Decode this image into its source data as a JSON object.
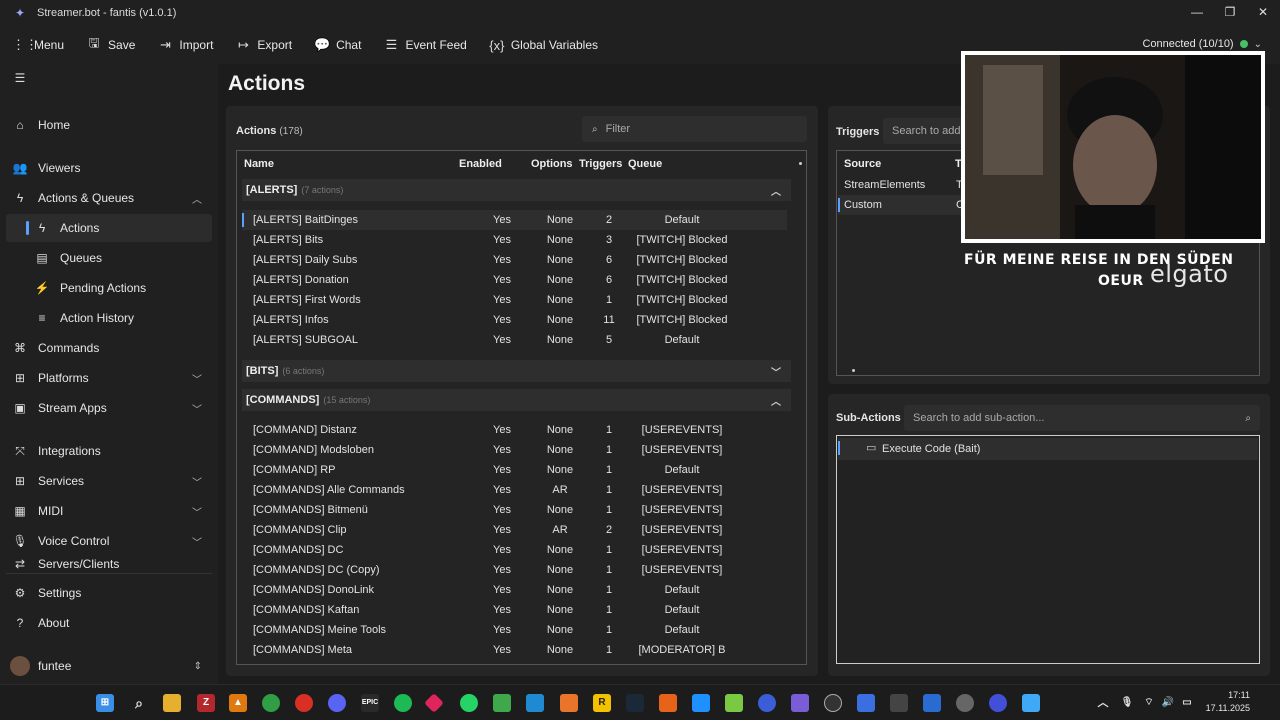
{
  "window": {
    "title": "Streamer.bot - fantis (v1.0.1)",
    "minimize_icon": "minimize-icon",
    "maximize_icon": "restore-icon",
    "close_icon": "close-icon"
  },
  "toolbar": {
    "menu": "Menu",
    "save": "Save",
    "import": "Import",
    "export": "Export",
    "chat": "Chat",
    "event_feed": "Event Feed",
    "global_variables": "Global Variables",
    "connection": "Connected (10/10)",
    "connection_color": "#44c16a"
  },
  "sidebar": {
    "home": "Home",
    "viewers": "Viewers",
    "actions_queues": "Actions & Queues",
    "actions": "Actions",
    "queues": "Queues",
    "pending_actions": "Pending Actions",
    "action_history": "Action History",
    "commands": "Commands",
    "platforms": "Platforms",
    "stream_apps": "Stream Apps",
    "integrations": "Integrations",
    "services": "Services",
    "midi": "MIDI",
    "voice_control": "Voice Control",
    "servers_clients": "Servers/Clients",
    "settings": "Settings",
    "about": "About",
    "user": "funtee"
  },
  "main": {
    "page_title": "Actions",
    "actions_panel": {
      "title": "Actions",
      "count": "(178)",
      "filter_placeholder": "Filter",
      "columns": [
        "Name",
        "Enabled",
        "Options",
        "Triggers",
        "Queue"
      ],
      "groups": [
        {
          "name": "[ALERTS]",
          "count": "(7 actions)",
          "expanded": true
        },
        {
          "name": "[BITS]",
          "count": "(6 actions)",
          "expanded": false
        },
        {
          "name": "[COMMANDS]",
          "count": "(15 actions)",
          "expanded": true
        }
      ],
      "alerts_rows": [
        [
          "[ALERTS] BaitDinges",
          "Yes",
          "None",
          "2",
          "Default"
        ],
        [
          "[ALERTS] Bits",
          "Yes",
          "None",
          "3",
          "[TWITCH] Blocked"
        ],
        [
          "[ALERTS] Daily Subs",
          "Yes",
          "None",
          "6",
          "[TWITCH] Blocked"
        ],
        [
          "[ALERTS] Donation",
          "Yes",
          "None",
          "6",
          "[TWITCH] Blocked"
        ],
        [
          "[ALERTS] First Words",
          "Yes",
          "None",
          "1",
          "[TWITCH] Blocked"
        ],
        [
          "[ALERTS] Infos",
          "Yes",
          "None",
          "11",
          "[TWITCH] Blocked"
        ],
        [
          "[ALERTS] SUBGOAL",
          "Yes",
          "None",
          "5",
          "Default"
        ]
      ],
      "command_rows": [
        [
          "[COMMAND] Distanz",
          "Yes",
          "None",
          "1",
          "[USEREVENTS]"
        ],
        [
          "[COMMAND] Modsloben",
          "Yes",
          "None",
          "1",
          "[USEREVENTS]"
        ],
        [
          "[COMMAND] RP",
          "Yes",
          "None",
          "1",
          "Default"
        ],
        [
          "[COMMANDS] Alle Commands",
          "Yes",
          "AR",
          "1",
          "[USEREVENTS]"
        ],
        [
          "[COMMANDS] Bitmenü",
          "Yes",
          "None",
          "1",
          "[USEREVENTS]"
        ],
        [
          "[COMMANDS] Clip",
          "Yes",
          "AR",
          "2",
          "[USEREVENTS]"
        ],
        [
          "[COMMANDS] DC",
          "Yes",
          "None",
          "1",
          "[USEREVENTS]"
        ],
        [
          "[COMMANDS] DC (Copy)",
          "Yes",
          "None",
          "1",
          "[USEREVENTS]"
        ],
        [
          "[COMMANDS] DonoLink",
          "Yes",
          "None",
          "1",
          "Default"
        ],
        [
          "[COMMANDS] Kaftan",
          "Yes",
          "None",
          "1",
          "Default"
        ],
        [
          "[COMMANDS] Meine Tools",
          "Yes",
          "None",
          "1",
          "Default"
        ],
        [
          "[COMMANDS] Meta",
          "Yes",
          "None",
          "1",
          "[MODERATOR] B"
        ]
      ]
    },
    "triggers_panel": {
      "title": "Triggers",
      "search_placeholder": "Search to add t",
      "columns": [
        "Source",
        "T"
      ],
      "rows": [
        [
          "StreamElements",
          "T"
        ],
        [
          "Custom",
          "C"
        ]
      ]
    },
    "subactions_panel": {
      "title": "Sub-Actions",
      "search_placeholder": "Search to add sub-action...",
      "items": [
        "Execute Code (Bait)"
      ]
    }
  },
  "overlay": {
    "line1": "FÜR MEINE REISE IN DEN SÜDEN",
    "line2": "OEUR",
    "brand": "elgato"
  },
  "taskbar": {
    "time": "17:11",
    "date": "17.11.2025"
  }
}
